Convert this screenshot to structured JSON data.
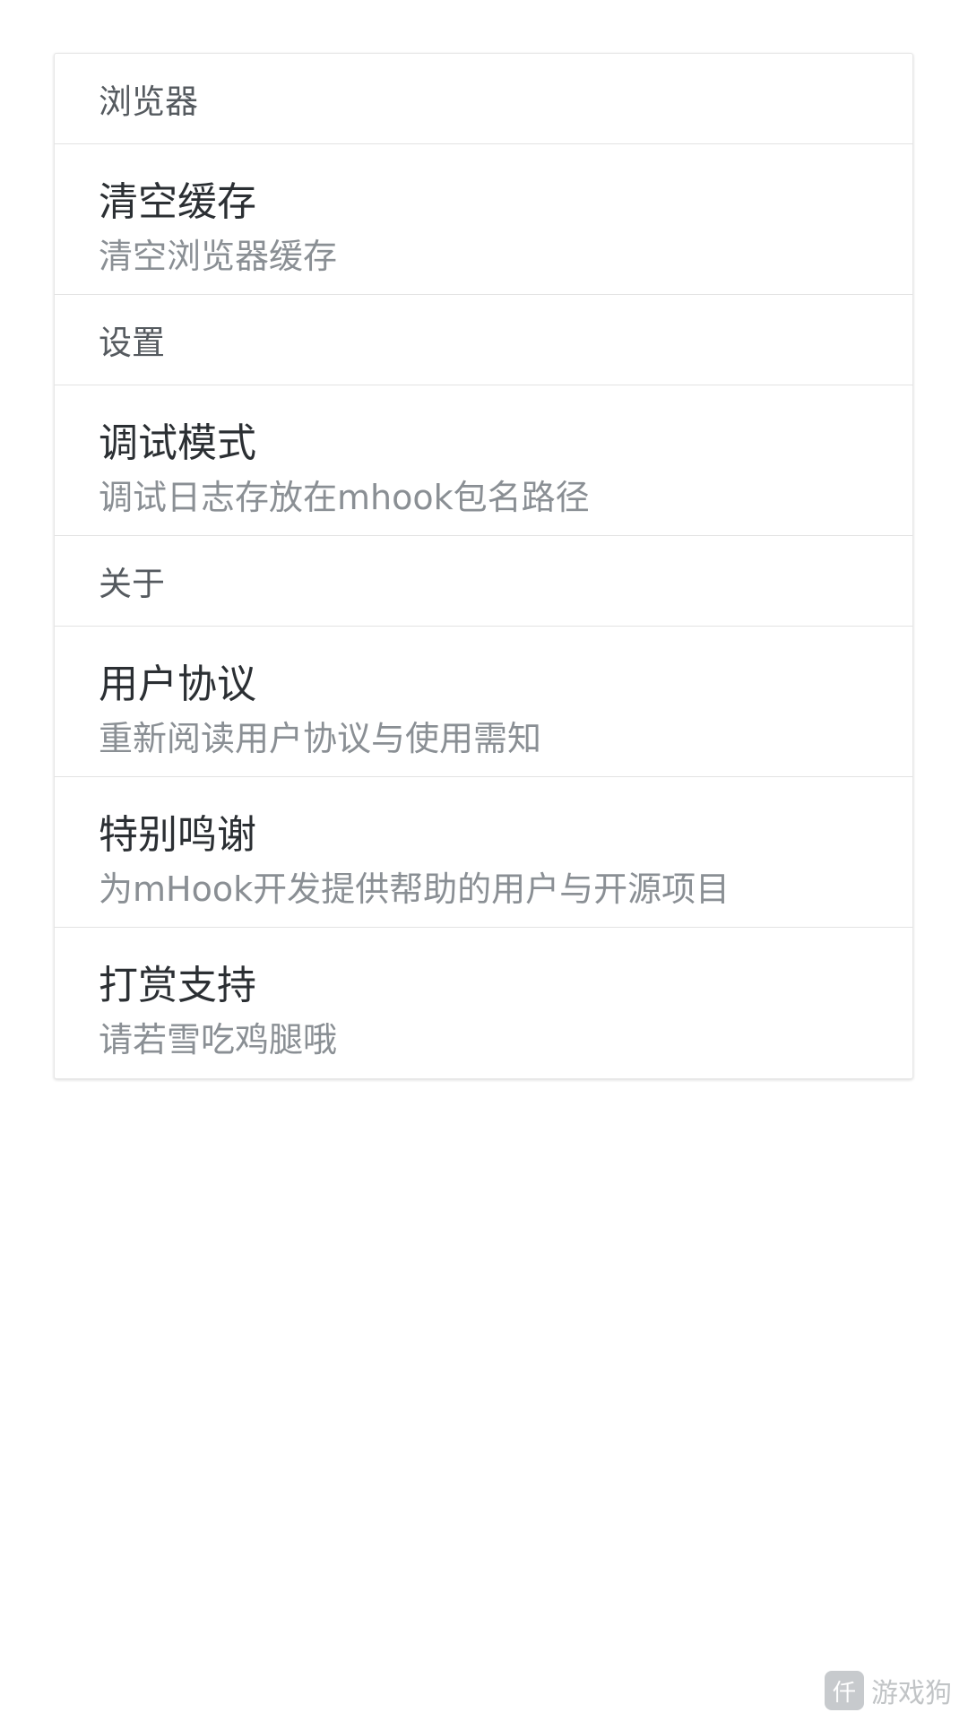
{
  "sections": {
    "browser": {
      "header": "浏览器",
      "clear_cache": {
        "title": "清空缓存",
        "subtitle": "清空浏览器缓存"
      }
    },
    "settings": {
      "header": "设置",
      "debug_mode": {
        "title": "调试模式",
        "subtitle": "调试日志存放在mhook包名路径"
      }
    },
    "about": {
      "header": "关于",
      "user_agreement": {
        "title": "用户协议",
        "subtitle": "重新阅读用户协议与使用需知"
      },
      "special_thanks": {
        "title": "特别鸣谢",
        "subtitle": "为mHook开发提供帮助的用户与开源项目"
      },
      "donate": {
        "title": "打赏支持",
        "subtitle": "请若雪吃鸡腿哦"
      }
    }
  },
  "watermark": {
    "text": "游戏狗",
    "logo_text": "仟"
  },
  "colors": {
    "background": "#ffffff",
    "title_text": "#2b2f33",
    "subtitle_text": "#8a8f94",
    "header_text": "#555a5f",
    "divider": "#e3e3e3"
  }
}
